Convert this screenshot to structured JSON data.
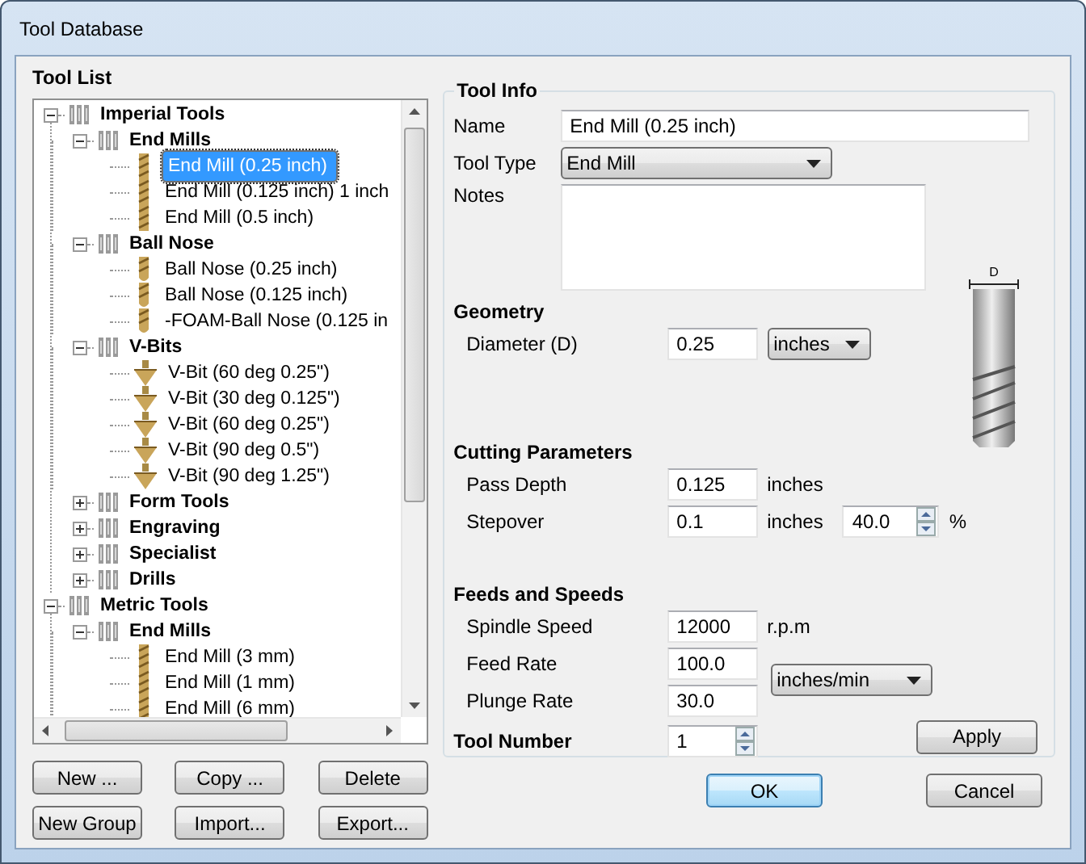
{
  "window": {
    "title": "Tool Database"
  },
  "tool_list": {
    "title": "Tool List",
    "tree": [
      {
        "label": "Imperial Tools",
        "kind": "group",
        "expanded": true,
        "selected": false,
        "children": [
          {
            "label": "End Mills",
            "kind": "group",
            "expanded": true,
            "selected": false,
            "children": [
              {
                "label": "End Mill (0.25 inch)",
                "kind": "end-mill",
                "selected": true
              },
              {
                "label": "End Mill (0.125 inch) 1 inch",
                "kind": "end-mill",
                "selected": false
              },
              {
                "label": "End Mill (0.5 inch)",
                "kind": "end-mill",
                "selected": false
              }
            ]
          },
          {
            "label": "Ball Nose",
            "kind": "group",
            "expanded": true,
            "selected": false,
            "children": [
              {
                "label": "Ball Nose (0.25 inch)",
                "kind": "ball-nose",
                "selected": false
              },
              {
                "label": "Ball Nose (0.125 inch)",
                "kind": "ball-nose",
                "selected": false
              },
              {
                "label": "-FOAM-Ball Nose (0.125 in",
                "kind": "ball-nose",
                "selected": false
              }
            ]
          },
          {
            "label": "V-Bits",
            "kind": "group",
            "expanded": true,
            "selected": false,
            "children": [
              {
                "label": "V-Bit (60 deg 0.25\")",
                "kind": "v-bit",
                "selected": false
              },
              {
                "label": "V-Bit (30 deg 0.125\")",
                "kind": "v-bit",
                "selected": false
              },
              {
                "label": "V-Bit (60 deg 0.25\")",
                "kind": "v-bit",
                "selected": false
              },
              {
                "label": "V-Bit (90 deg 0.5\")",
                "kind": "v-bit",
                "selected": false
              },
              {
                "label": "V-Bit (90 deg 1.25\")",
                "kind": "v-bit",
                "selected": false
              }
            ]
          },
          {
            "label": "Form Tools",
            "kind": "group",
            "expanded": false,
            "selected": false
          },
          {
            "label": "Engraving",
            "kind": "group",
            "expanded": false,
            "selected": false
          },
          {
            "label": "Specialist",
            "kind": "group",
            "expanded": false,
            "selected": false
          },
          {
            "label": "Drills",
            "kind": "group",
            "expanded": false,
            "selected": false
          }
        ]
      },
      {
        "label": "Metric Tools",
        "kind": "group",
        "expanded": true,
        "selected": false,
        "children": [
          {
            "label": "End Mills",
            "kind": "group",
            "expanded": true,
            "selected": false,
            "children": [
              {
                "label": "End Mill (3 mm)",
                "kind": "end-mill",
                "selected": false
              },
              {
                "label": "End Mill (1 mm)",
                "kind": "end-mill",
                "selected": false
              },
              {
                "label": "End Mill (6 mm)",
                "kind": "end-mill",
                "selected": false
              }
            ]
          }
        ]
      }
    ]
  },
  "tree_buttons": [
    "New ...",
    "Copy ...",
    "Delete",
    "New Group",
    "Import...",
    "Export..."
  ],
  "tool_info": {
    "title": "Tool Info",
    "name_label": "Name",
    "name": "End Mill (0.25 inch)",
    "tool_type_label": "Tool Type",
    "tool_type": "End Mill",
    "notes_label": "Notes"
  },
  "geometry": {
    "title": "Geometry",
    "diameter_label": "Diameter (D)",
    "diameter": "0.25",
    "diameter_units": "inches",
    "diagram_label": "D"
  },
  "cutting": {
    "title": "Cutting Parameters",
    "pass_depth_label": "Pass Depth",
    "pass_depth": "0.125",
    "pass_depth_units": "inches",
    "stepover_label": "Stepover",
    "stepover": "0.1",
    "stepover_units": "inches",
    "stepover_percent": "40.0",
    "percent_sign": "%"
  },
  "feeds": {
    "title": "Feeds and Speeds",
    "spindle_label": "Spindle Speed",
    "spindle": "12000",
    "spindle_units": "r.p.m",
    "feed_label": "Feed Rate",
    "feed": "100.0",
    "plunge_label": "Plunge Rate",
    "plunge": "30.0",
    "rate_units": "inches/min"
  },
  "tool_number": {
    "label": "Tool Number",
    "value": "1"
  },
  "apply_button": "Apply",
  "dialog_buttons": [
    {
      "label": "OK",
      "default": true
    },
    {
      "label": "Cancel",
      "default": false
    }
  ]
}
